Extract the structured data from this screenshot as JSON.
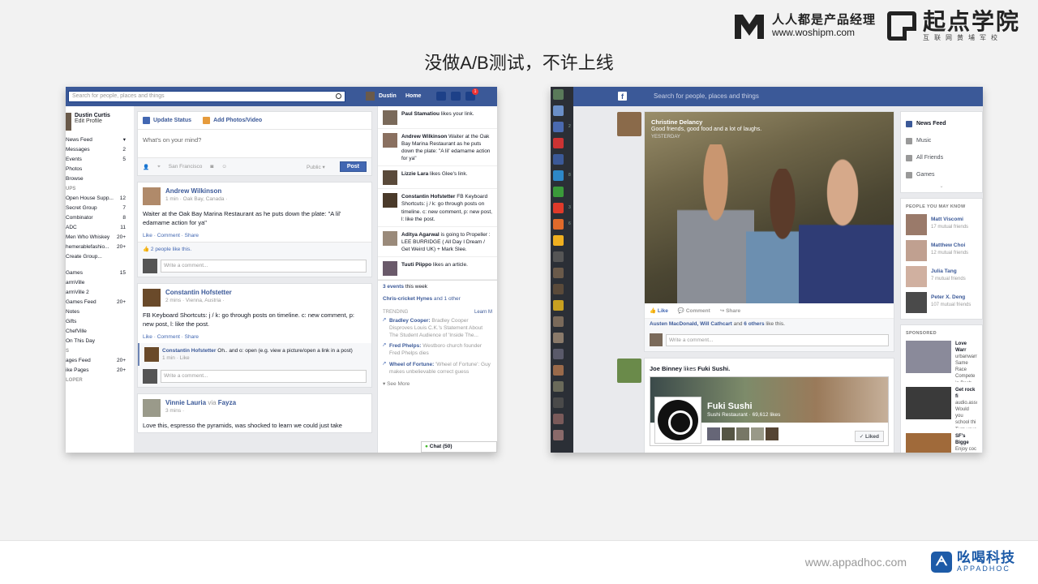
{
  "brand": {
    "cn": "人人都是产品经理",
    "url": "www.woshipm.com",
    "brand2_cn": "起点学院",
    "brand2_sub": "互联网黄埔军校"
  },
  "slide_title": "没做A/B测试，不许上线",
  "footer": {
    "url": "www.appadhoc.com",
    "logo_cn": "吆喝科技",
    "logo_en": "APPADHOC"
  },
  "old_fb": {
    "search_placeholder": "Search for people, places and things",
    "user": "Dustin",
    "home": "Home",
    "notif_count": "1",
    "profile_name": "Dustin Curtis",
    "profile_edit": "Edit Profile",
    "left_items": [
      {
        "label": "News Feed",
        "count": "▾"
      },
      {
        "label": "Messages",
        "count": "2"
      },
      {
        "label": "Events",
        "count": "5"
      },
      {
        "label": "Photos",
        "count": ""
      },
      {
        "label": "Browse",
        "count": ""
      }
    ],
    "groups_section": "UPS",
    "group_items": [
      {
        "label": "Open House Supp...",
        "count": "12"
      },
      {
        "label": "Secret Group",
        "count": "7"
      },
      {
        "label": "Combinator",
        "count": "8"
      },
      {
        "label": "ADC",
        "count": "11"
      },
      {
        "label": "Men Who Whiskey",
        "count": "20+"
      },
      {
        "label": "hemerablefashio...",
        "count": "20+"
      },
      {
        "label": "Create Group...",
        "count": ""
      }
    ],
    "app_items": [
      {
        "label": "Games",
        "count": "15"
      },
      {
        "label": "armVille",
        "count": ""
      },
      {
        "label": "armVille 2",
        "count": ""
      },
      {
        "label": "Games Feed",
        "count": "20+"
      },
      {
        "label": "Notes",
        "count": ""
      },
      {
        "label": "Gifts",
        "count": ""
      },
      {
        "label": "ChefVille",
        "count": ""
      },
      {
        "label": "On This Day",
        "count": ""
      }
    ],
    "pages_section": "S",
    "page_items": [
      {
        "label": "ages Feed",
        "count": "20+"
      },
      {
        "label": "ike Pages",
        "count": "20+"
      }
    ],
    "dev_section": "LOPER",
    "composer": {
      "update_status": "Update Status",
      "add_photos": "Add Photos/Video",
      "placeholder": "What's on your mind?",
      "location": "San Francisco",
      "audience": "Public ▾",
      "post": "Post"
    },
    "posts": [
      {
        "name": "Andrew Wilkinson",
        "meta": "1 min · Oak Bay, Canada ·",
        "text": "Waiter at the Oak Bay Marina Restaurant as he puts down the plate: \"A lil' edamame action for ya\"",
        "actions": "Like · Comment · Share",
        "likes": "2 people like this.",
        "comment_ph": "Write a comment..."
      },
      {
        "name": "Constantin Hofstetter",
        "meta": "2 mins · Vienna, Austria ·",
        "text": "FB Keyboard Shortcuts: j / k: go through posts on timeline. c: new comment, p: new post, l: like the post.",
        "actions": "Like · Comment · Share",
        "reply_name": "Constantin Hofstetter",
        "reply_text": "Oh.. and o: open (e.g. view a picture/open a link in a post)",
        "reply_meta": "1 min · Like",
        "comment_ph": "Write a comment..."
      },
      {
        "name": "Vinnie Lauria",
        "via": "via",
        "via_name": "Fayza",
        "meta": "3 mins ·",
        "text": "Love this, espresso the pyramids, was shocked to learn we could just take"
      }
    ],
    "ticker": [
      {
        "name": "Paul Stamatiou",
        "text": "likes your link."
      },
      {
        "name": "Andrew Wilkinson",
        "text": "Waiter at the Oak Bay Marina Restaurant as he puts down the plate: \"A lil' edamame action for ya\""
      },
      {
        "name": "Lizzie Lara",
        "text": "likes Glee's link."
      },
      {
        "name": "Constantin Hofstetter",
        "text": "FB Keyboard Shortcuts: j / k: go through posts on timeline. c: new comment, p: new post, l: like the post."
      },
      {
        "name": "Aditya Agarwal",
        "text": "is going to Propeller : LEE BURRIDGE ( All Day I Dream / Get Weird UK) + Mark Slee."
      },
      {
        "name": "Tuuti Piippo",
        "text": "likes an article."
      }
    ],
    "events": "3 events",
    "events_suffix": "this week",
    "birthdays": "Chris-cricket Hynes",
    "birthdays_suffix": "and 1 other",
    "trending_title": "TRENDING",
    "learn_more": "Learn M",
    "trends": [
      {
        "name": "Bradley Cooper:",
        "text": "Bradley Cooper Disproves Louis C.K.'s Statement About The Student Audience of 'Inside The..."
      },
      {
        "name": "Fred Phelps:",
        "text": "Westboro church founder Fred Phelps dies"
      },
      {
        "name": "Wheel of Fortune:",
        "text": "'Wheel of Fortune': Guy makes unbelievable correct guess"
      }
    ],
    "see_more": "▾ See More",
    "chat": "Chat (50)"
  },
  "new_fb": {
    "search_placeholder": "Search for people, places and things",
    "sidebar_counts": [
      "2",
      "8",
      "3",
      "6"
    ],
    "hero": {
      "name": "Christine Delancy",
      "text": "Good friends, good food and a lot of laughs.",
      "time": "YESTERDAY"
    },
    "actions": {
      "like": "Like",
      "comment": "Comment",
      "share": "Share"
    },
    "likes": {
      "names": "Austen MacDonald, Will Cathcart",
      "and": "and",
      "others": "6 others",
      "suffix": "like this."
    },
    "comment_ph": "Write a comment...",
    "post2": {
      "name": "Joe Binney",
      "verb": "likes",
      "page": "Fuki Sushi.",
      "page_name": "Fuki Sushi",
      "page_cat": "Sushi Restaurant · 69,612 likes",
      "liked": "✓ Liked"
    },
    "nav": [
      "News Feed",
      "Music",
      "All Friends",
      "Games"
    ],
    "pymk_title": "PEOPLE YOU MAY KNOW",
    "pymk": [
      {
        "name": "Matt Viscomi",
        "sub": "17 mutual friends"
      },
      {
        "name": "Matthew Choi",
        "sub": "12 mutual friends"
      },
      {
        "name": "Julia Tang",
        "sub": "7 mutual friends"
      },
      {
        "name": "Peter X. Deng",
        "sub": "107 mutual friends"
      }
    ],
    "sponsored_title": "SPONSORED",
    "sponsored": [
      {
        "title": "Love Warr",
        "text": "urbanwarm Same Race Compete in Dash 5D R This Day"
      },
      {
        "title": "Get rock fi",
        "text": "audio.asso Would you school thi Turn your professio"
      },
      {
        "title": "SF's Bigge",
        "text": "Enjoy coc"
      }
    ]
  }
}
